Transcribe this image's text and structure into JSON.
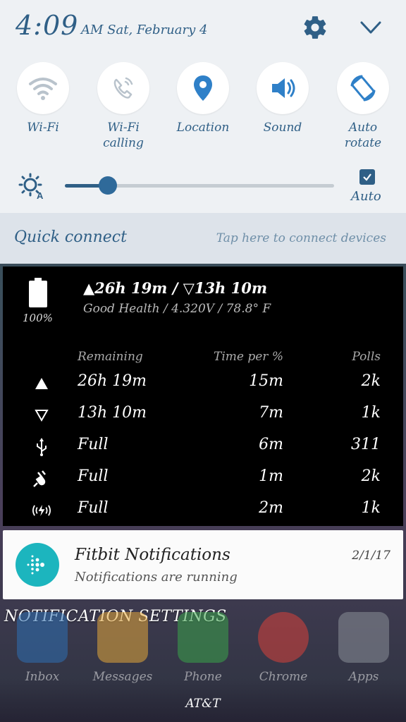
{
  "status": {
    "time": "4:09",
    "ampm_date": "AM Sat, February 4"
  },
  "quick_toggles": [
    {
      "label": "Wi-Fi",
      "icon": "wifi-icon"
    },
    {
      "label": "Wi-Fi\ncalling",
      "icon": "wifi-calling-icon"
    },
    {
      "label": "Location",
      "icon": "location-pin-icon"
    },
    {
      "label": "Sound",
      "icon": "speaker-icon"
    },
    {
      "label": "Auto\nrotate",
      "icon": "auto-rotate-icon"
    }
  ],
  "brightness": {
    "level": 0.16,
    "auto_label": "Auto",
    "auto_checked": true
  },
  "quick_connect": {
    "title": "Quick connect",
    "hint": "Tap here to connect devices"
  },
  "battery_widget": {
    "percent": "100%",
    "summary": "▲26h 19m / ▽13h 10m",
    "health": "Good Health / 4.320V / 78.8° F",
    "headers": {
      "remaining": "Remaining",
      "time_per": "Time per %",
      "polls": "Polls"
    },
    "rows": [
      {
        "icon": "discharge-active-icon",
        "remaining": "26h 19m",
        "time_per": "15m",
        "polls": "2k"
      },
      {
        "icon": "discharge-idle-icon",
        "remaining": "13h 10m",
        "time_per": "7m",
        "polls": "1k"
      },
      {
        "icon": "usb-icon",
        "remaining": "Full",
        "time_per": "6m",
        "polls": "311"
      },
      {
        "icon": "ac-plug-icon",
        "remaining": "Full",
        "time_per": "1m",
        "polls": "2k"
      },
      {
        "icon": "wireless-charge-icon",
        "remaining": "Full",
        "time_per": "2m",
        "polls": "1k"
      }
    ]
  },
  "notification": {
    "title": "Fitbit Notifications",
    "subtitle": "Notifications are running",
    "date": "2/1/17"
  },
  "notification_settings": "NOTIFICATION SETTINGS",
  "dock": [
    {
      "name": "Inbox",
      "color": "#2e6fb3"
    },
    {
      "name": "Messages",
      "color": "#e2a63a"
    },
    {
      "name": "Phone",
      "color": "#3aa34a"
    },
    {
      "name": "Chrome",
      "color": "#d8413a"
    },
    {
      "name": "Apps",
      "color": "#8a8f98"
    }
  ],
  "carrier": "AT&T",
  "colors": {
    "accent": "#2f5f86",
    "fitbit": "#1cb5be"
  }
}
